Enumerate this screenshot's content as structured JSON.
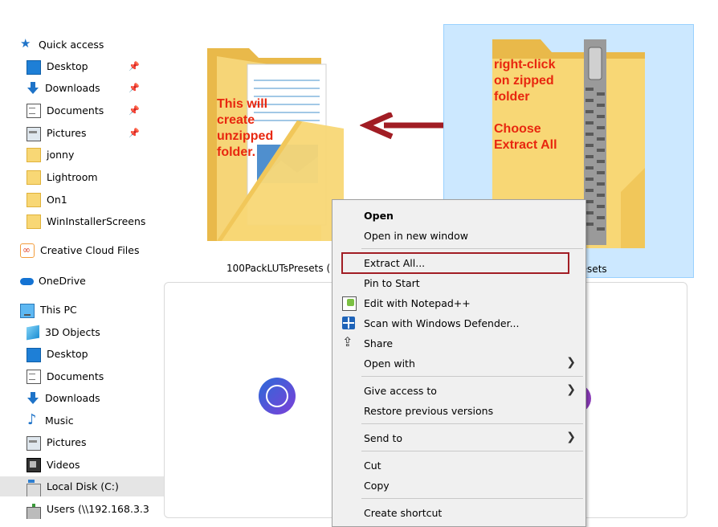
{
  "nav": {
    "quick_access": "Quick access",
    "quick_items": [
      {
        "label": "Desktop",
        "icon": "desktop-icon",
        "pinned": true
      },
      {
        "label": "Downloads",
        "icon": "downloads-icon",
        "pinned": true
      },
      {
        "label": "Documents",
        "icon": "documents-icon",
        "pinned": true
      },
      {
        "label": "Pictures",
        "icon": "pictures-icon",
        "pinned": true
      },
      {
        "label": "jonny",
        "icon": "folder-icon",
        "pinned": false
      },
      {
        "label": "Lightroom",
        "icon": "folder-icon",
        "pinned": false
      },
      {
        "label": "On1",
        "icon": "folder-icon",
        "pinned": false
      },
      {
        "label": "WinInstallerScreens",
        "icon": "folder-icon",
        "pinned": false
      }
    ],
    "creative_cloud": "Creative Cloud Files",
    "onedrive": "OneDrive",
    "this_pc": "This PC",
    "pc_items": [
      {
        "label": "3D Objects",
        "icon": "3d-objects-icon"
      },
      {
        "label": "Desktop",
        "icon": "desktop-icon"
      },
      {
        "label": "Documents",
        "icon": "documents-icon"
      },
      {
        "label": "Downloads",
        "icon": "downloads-icon"
      },
      {
        "label": "Music",
        "icon": "music-icon"
      },
      {
        "label": "Pictures",
        "icon": "pictures-icon"
      },
      {
        "label": "Videos",
        "icon": "videos-icon"
      },
      {
        "label": "Local Disk (C:)",
        "icon": "local-disk-icon",
        "selected": true
      },
      {
        "label": "Users (\\\\192.168.3.3",
        "icon": "network-drive-icon"
      }
    ]
  },
  "content": {
    "left_folder_label": "100PackLUTsPresets (",
    "right_folder_label": "resets",
    "left_annotation": "This will\ncreate\nunzipped\nfolder.",
    "right_annotation": "right-click\non zipped\nfolder\n\nChoose\nExtract All"
  },
  "context_menu": {
    "items": [
      {
        "label": "Open",
        "bold": true
      },
      {
        "label": "Open in new window"
      },
      {
        "label": "Extract All...",
        "highlighted": true
      },
      {
        "label": "Pin to Start"
      },
      {
        "label": "Edit with Notepad++",
        "icon": "notepad-icon"
      },
      {
        "label": "Scan with Windows Defender...",
        "icon": "defender-icon"
      },
      {
        "label": "Share",
        "icon": "share-icon"
      },
      {
        "label": "Open with",
        "submenu": true
      },
      {
        "label": "Give access to",
        "submenu": true
      },
      {
        "label": "Restore previous versions"
      },
      {
        "label": "Send to",
        "submenu": true
      },
      {
        "label": "Cut"
      },
      {
        "label": "Copy"
      },
      {
        "label": "Create shortcut"
      }
    ]
  },
  "colors": {
    "annotation": "#e8270f",
    "arrow": "#a11d24",
    "selection": "#cce8ff",
    "folder": "#f8d775"
  }
}
